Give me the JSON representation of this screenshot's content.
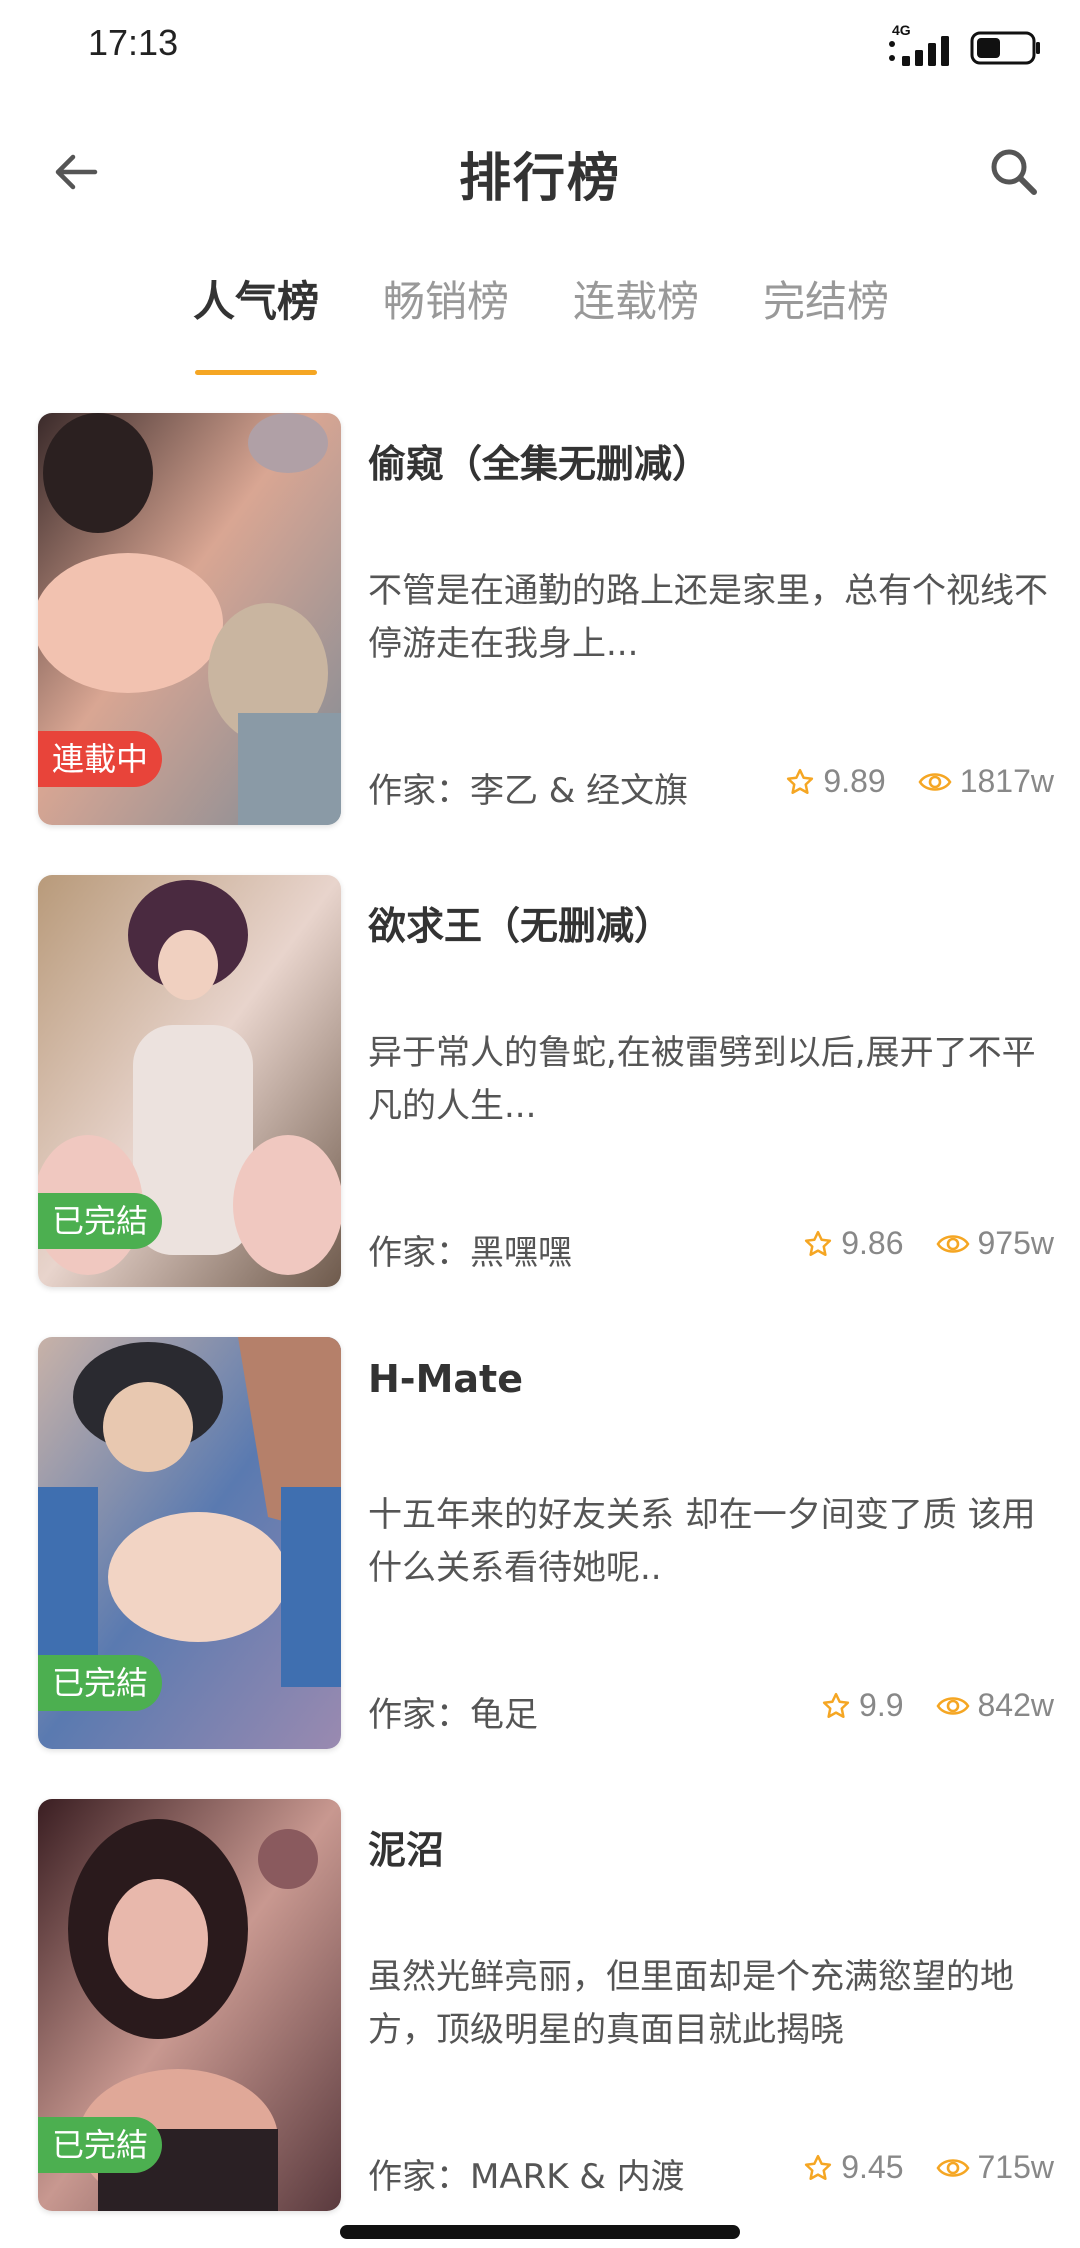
{
  "status_bar": {
    "time": "17:13",
    "network": "4G",
    "battery_level": 0.45
  },
  "header": {
    "title": "排行榜",
    "back_icon": "arrow-left-icon",
    "search_icon": "search-icon"
  },
  "tabs": [
    {
      "label": "人气榜",
      "active": true
    },
    {
      "label": "畅销榜",
      "active": false
    },
    {
      "label": "连载榜",
      "active": false
    },
    {
      "label": "完结榜",
      "active": false
    }
  ],
  "colors": {
    "accent": "#f5a623",
    "badge_ongoing": "#e8443a",
    "badge_done": "#4caf50"
  },
  "items": [
    {
      "title": "偷窥（全集无删减）",
      "description": "不管是在通勤的路上还是家里，总有个视线不停游走在我身上...",
      "author": "作家：李乙 & 经文旗",
      "rating": "9.89",
      "views": "1817w",
      "badge": "連載中",
      "status": "ongoing"
    },
    {
      "title": "欲求王（无删减）",
      "description": "异于常人的鲁蛇,在被雷劈到以后,展开了不平凡的人生...",
      "author": "作家：黑嘿嘿",
      "rating": "9.86",
      "views": "975w",
      "badge": "已完結",
      "status": "done"
    },
    {
      "title": "H-Mate",
      "description": "十五年来的好友关系 却在一夕间变了质 该用什么关系看待她呢..",
      "author": "作家：龟足",
      "rating": "9.9",
      "views": "842w",
      "badge": "已完結",
      "status": "done"
    },
    {
      "title": "泥沼",
      "description": "虽然光鲜亮丽，但里面却是个充满慾望的地方，顶级明星的真面目就此揭晓",
      "author": "作家：MARK & 内渡",
      "rating": "9.45",
      "views": "715w",
      "badge": "已完結",
      "status": "done"
    }
  ]
}
